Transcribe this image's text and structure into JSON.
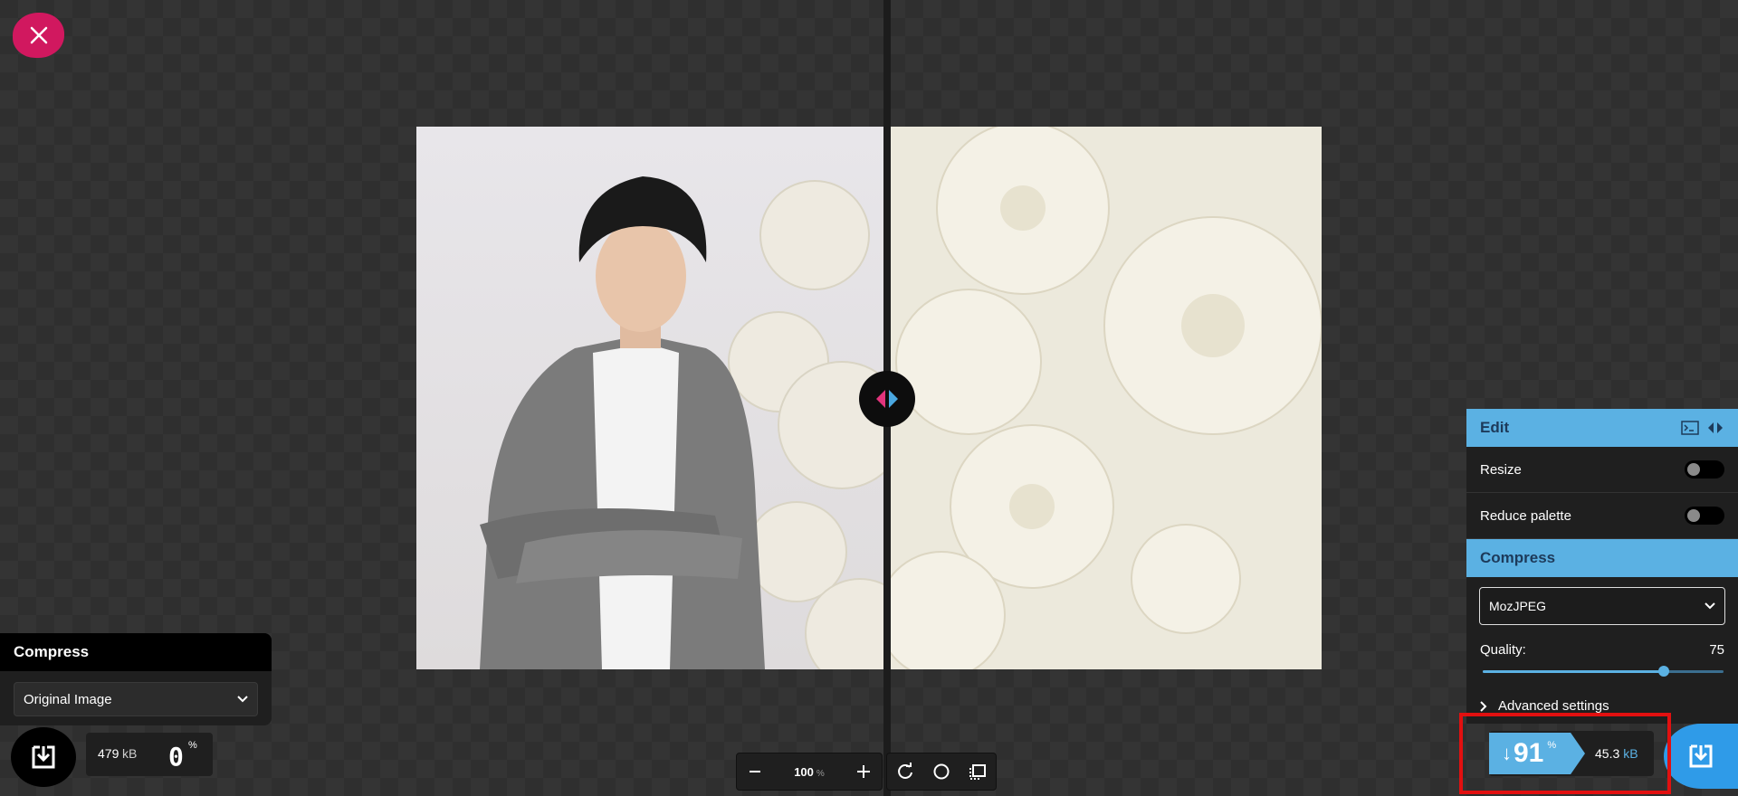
{
  "left_panel": {
    "title": "Compress",
    "select_value": "Original Image",
    "size_value": "479",
    "size_unit": "kB",
    "percent_value": "0",
    "percent_sign": "%"
  },
  "zoom": {
    "value": "100",
    "unit": "%"
  },
  "right_panel": {
    "edit_title": "Edit",
    "resize_label": "Resize",
    "reduce_palette_label": "Reduce palette",
    "compress_title": "Compress",
    "codec_value": "MozJPEG",
    "quality_label": "Quality:",
    "quality_value": "75",
    "quality_fraction": 0.75,
    "advanced_label": "Advanced settings"
  },
  "result": {
    "arrow": "↓",
    "percent": "91",
    "percent_sign": "%",
    "size_value": "45.3",
    "size_unit": "kB"
  },
  "colors": {
    "accent_blue": "#5bb1e3",
    "close_pink": "#d1185f",
    "highlight_red": "#e21010",
    "download_blue": "#2f9be8"
  },
  "icons": {
    "close": "close-icon",
    "download": "download-icon",
    "split_handle": "split-arrows-icon",
    "terminal": "terminal-icon",
    "swap": "swap-sides-icon",
    "rotate": "rotate-icon",
    "background_toggle": "circle-icon",
    "pixel_fit": "fit-screen-icon"
  }
}
